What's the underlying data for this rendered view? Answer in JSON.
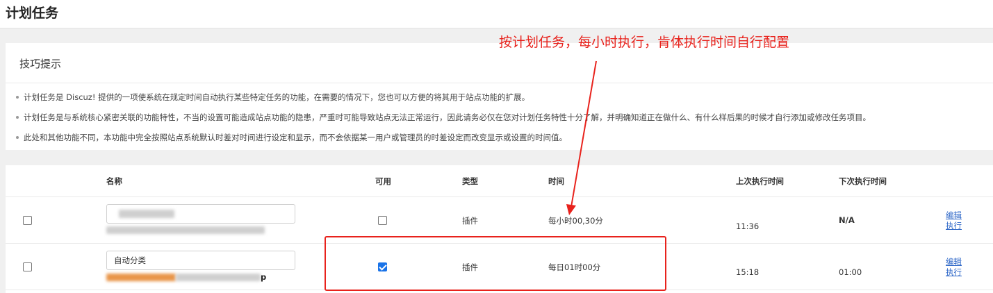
{
  "page": {
    "title": "计划任务"
  },
  "annotation": {
    "text": "按计划任务，每小时执行，肯体执行时间自行配置"
  },
  "tips": {
    "heading": "技巧提示",
    "items": [
      "计划任务是 Discuz! 提供的一项使系统在规定时间自动执行某些特定任务的功能，在需要的情况下，您也可以方便的将其用于站点功能的扩展。",
      "计划任务是与系统核心紧密关联的功能特性，不当的设置可能造成站点功能的隐患，严重时可能导致站点无法正常运行，因此请务必仅在您对计划任务特性十分了解，并明确知道正在做什么、有什么样后果的时候才自行添加或修改任务项目。",
      "此处和其他功能不同，本功能中完全按照站点系统默认时差对时间进行设定和显示，而不会依据某一用户或管理员的时差设定而改变显示或设置的时间值。"
    ]
  },
  "table": {
    "headers": {
      "name": "名称",
      "enabled": "可用",
      "type": "类型",
      "time": "时间",
      "last_run": "上次执行时间",
      "next_run": "下次执行时间"
    },
    "rows": [
      {
        "name_value": "",
        "plugin_id": "",
        "enabled": false,
        "type": "插件",
        "time": "每小时00,30分",
        "last_run": "11:36",
        "next_run": "N/A",
        "edit_label": "编辑",
        "run_label": "执行"
      },
      {
        "name_value": "自动分类",
        "plugin_id": "",
        "plugin_id_suffix": "p",
        "enabled": true,
        "type": "插件",
        "time": "每日01时00分",
        "last_run": "15:18",
        "next_run": "01:00",
        "edit_label": "编辑",
        "run_label": "执行"
      }
    ]
  },
  "colors": {
    "annotation": "#e8221c",
    "link": "#2b65c7",
    "checkbox_checked": "#1a73e8"
  }
}
